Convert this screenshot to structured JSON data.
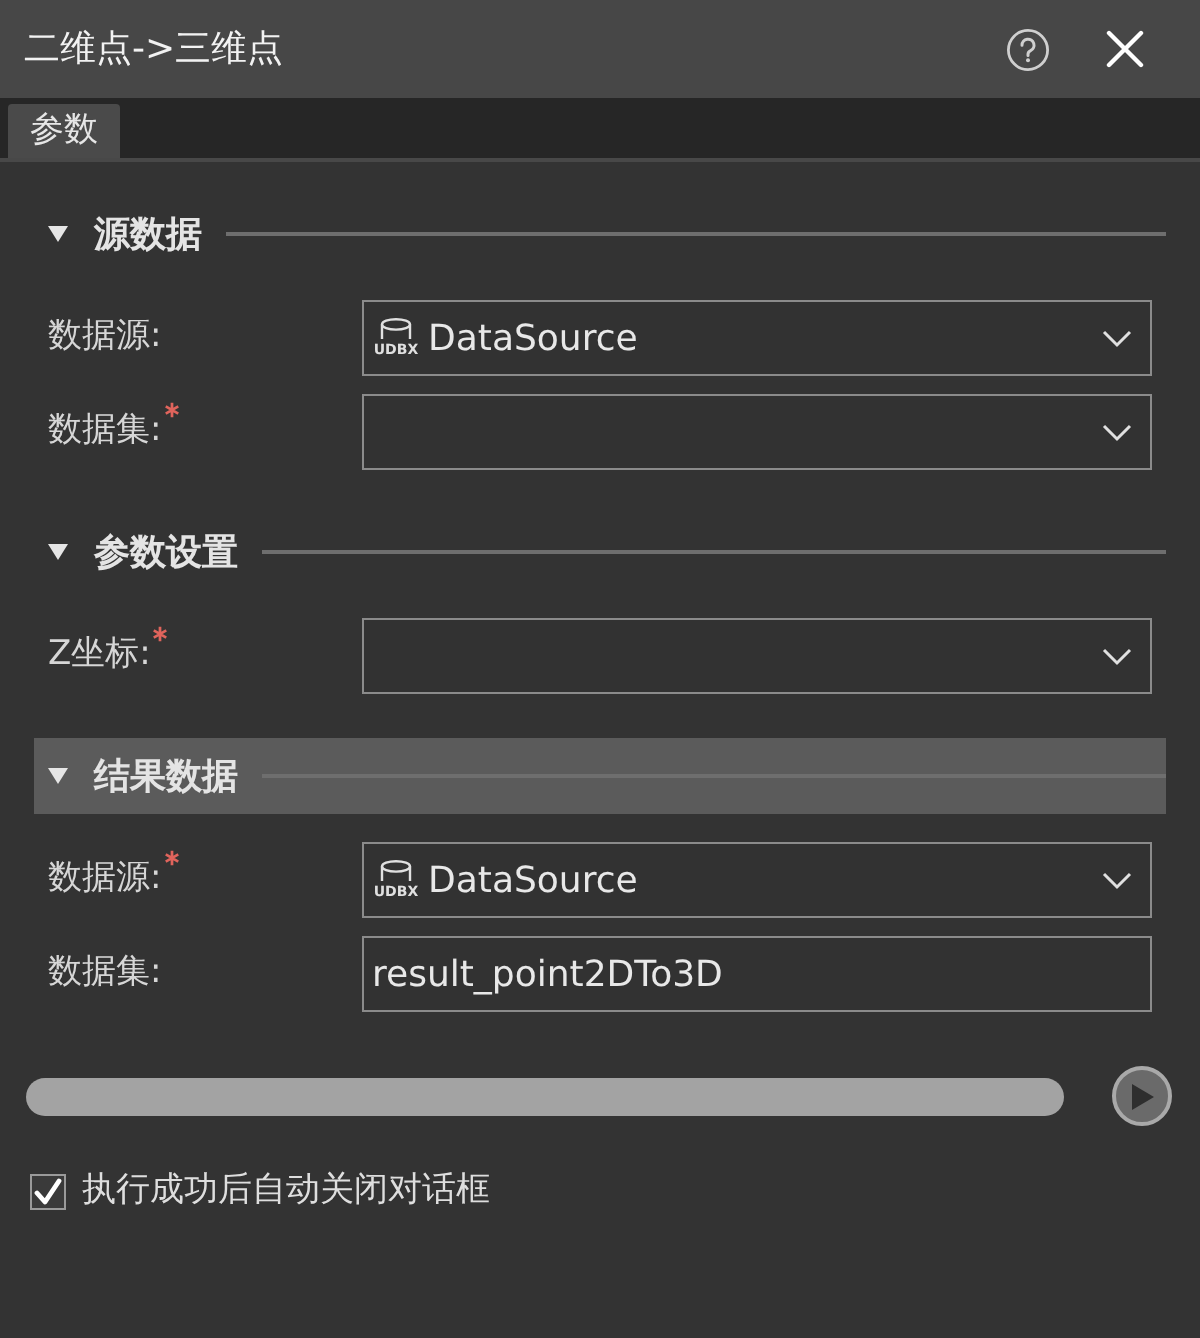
{
  "window": {
    "title": "二维点->三维点"
  },
  "tabs": [
    {
      "label": "参数",
      "selected": true
    }
  ],
  "sections": [
    {
      "title": "源数据",
      "expanded": true,
      "highlighted": false,
      "fields": [
        {
          "label": "数据源:",
          "required": false,
          "kind": "select",
          "value": "DataSource",
          "source_type": "UDBX"
        },
        {
          "label": "数据集:",
          "required": true,
          "kind": "select"
        }
      ]
    },
    {
      "title": "参数设置",
      "expanded": true,
      "highlighted": false,
      "fields": [
        {
          "label": "Z坐标:",
          "required": true,
          "kind": "select"
        }
      ]
    },
    {
      "title": "结果数据",
      "expanded": true,
      "highlighted": true,
      "fields": [
        {
          "label": "数据源:",
          "required": true,
          "kind": "select",
          "value": "DataSource",
          "source_type": "UDBX"
        },
        {
          "label": "数据集:",
          "required": false,
          "kind": "text",
          "value": "result_point2DTo3D"
        }
      ]
    }
  ],
  "auto_close": {
    "label": "执行成功后自动关闭对话框",
    "checked": true
  }
}
